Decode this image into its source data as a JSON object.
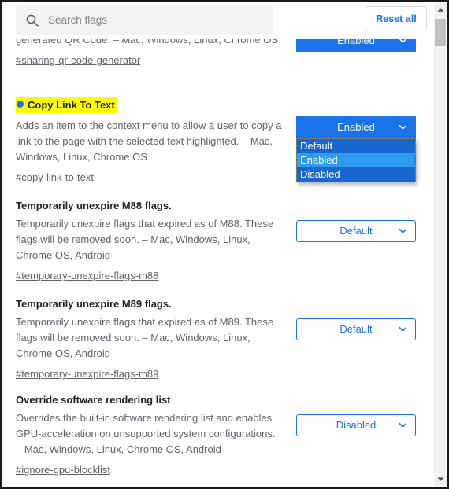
{
  "search": {
    "placeholder": "Search flags",
    "value": "",
    "icon": "search-icon"
  },
  "header": {
    "reset_all_label": "Reset all"
  },
  "flags": [
    {
      "title": "",
      "highlighted": false,
      "has_dot": false,
      "desc": "Enables right click UI to share the page's URL via a generated QR Code. – Mac, Windows, Linux, Chrome OS",
      "permalink": "#sharing-qr-code-generator",
      "select_value": "Enabled",
      "select_style": "filled",
      "open": false
    },
    {
      "title": "Copy Link To Text",
      "highlighted": true,
      "has_dot": true,
      "desc": "Adds an item to the context menu to allow a user to copy a link to the page with the selected text highlighted. – Mac, Windows, Linux, Chrome OS",
      "permalink": "#copy-link-to-text",
      "select_value": "Enabled",
      "select_style": "filled",
      "open": true,
      "options": [
        "Default",
        "Enabled",
        "Disabled"
      ],
      "selected_option": "Enabled"
    },
    {
      "title": "Temporarily unexpire M88 flags.",
      "highlighted": false,
      "has_dot": false,
      "desc": "Temporarily unexpire flags that expired as of M88. These flags will be removed soon. – Mac, Windows, Linux, Chrome OS, Android",
      "permalink": "#temporary-unexpire-flags-m88",
      "select_value": "Default",
      "select_style": "outline",
      "open": false
    },
    {
      "title": "Temporarily unexpire M89 flags.",
      "highlighted": false,
      "has_dot": false,
      "desc": "Temporarily unexpire flags that expired as of M89. These flags will be removed soon. – Mac, Windows, Linux, Chrome OS, Android",
      "permalink": "#temporary-unexpire-flags-m89",
      "select_value": "Default",
      "select_style": "outline",
      "open": false
    },
    {
      "title": "Override software rendering list",
      "highlighted": false,
      "has_dot": false,
      "desc": "Overrides the built-in software rendering list and enables GPU-acceleration on unsupported system configurations. – Mac, Windows, Linux, Chrome OS, Android",
      "permalink": "#ignore-gpu-blocklist",
      "select_value": "Disabled",
      "select_style": "outline",
      "open": false
    }
  ],
  "scrollbar": {
    "up_icon": "triangle-up-icon",
    "down_icon": "triangle-down-icon",
    "thumb": "scrollbar-thumb"
  },
  "colors": {
    "accent_blue": "#1a73e8",
    "dropdown_bg": "#1a66d0",
    "dropdown_selected": "#2d9bf0",
    "highlight_yellow": "#ffff00",
    "text_primary": "#202124",
    "text_secondary": "#5f6368"
  }
}
